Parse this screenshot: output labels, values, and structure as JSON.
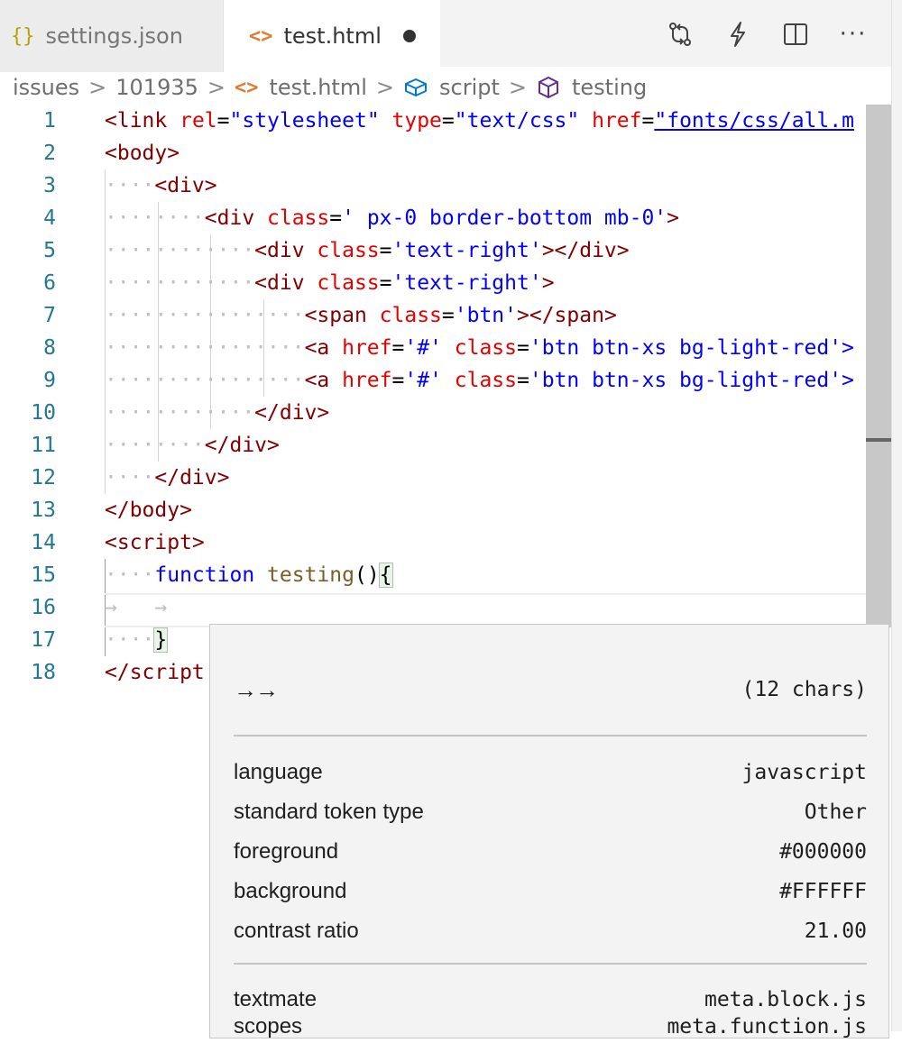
{
  "tabs": [
    {
      "label": "settings.json",
      "icon": "braces-icon",
      "active": false
    },
    {
      "label": "test.html",
      "icon": "angle-brackets-icon",
      "active": true,
      "dirty": true
    }
  ],
  "tab_glyphs": {
    "braces": "{}",
    "angle": "<>"
  },
  "actions": [
    "compare-changes-icon",
    "lightning-icon",
    "split-editor-icon",
    "more-icon"
  ],
  "more_glyph": "···",
  "breadcrumb": {
    "items": [
      "issues",
      "101935",
      "test.html",
      "script",
      "testing"
    ],
    "separator": ">"
  },
  "line_numbers": [
    "1",
    "2",
    "3",
    "4",
    "5",
    "6",
    "7",
    "8",
    "9",
    "10",
    "11",
    "12",
    "13",
    "14",
    "15",
    "16",
    "17",
    "18"
  ],
  "code": {
    "l1": {
      "a": "<link",
      "b": " rel",
      "c": "=",
      "d": "\"stylesheet\"",
      "e": " type",
      "f": "=",
      "g": "\"text/css\"",
      "h": " href",
      "i": "=",
      "j": "\"fonts/css/all.m"
    },
    "l2": "<body>",
    "l3": {
      "ws": "····",
      "t": "<div>"
    },
    "l4": {
      "ws": "········",
      "t1": "<div",
      "a": " class",
      "e": "=",
      "s": "' px-0 border-bottom mb-0'",
      "t2": ">"
    },
    "l5": {
      "ws": "············",
      "t1": "<div",
      "a": " class",
      "e": "=",
      "s": "'text-right'",
      "t2": "></div>"
    },
    "l6": {
      "ws": "············",
      "t1": "<div",
      "a": " class",
      "e": "=",
      "s": "'text-right'",
      "t2": ">"
    },
    "l7": {
      "ws": "················",
      "t1": "<span",
      "a": " class",
      "e": "=",
      "s": "'btn'",
      "t2": "></span>"
    },
    "l8": {
      "ws": "················",
      "t1": "<a",
      "a1": " href",
      "e1": "=",
      "s1": "'#'",
      "a2": " class",
      "e2": "=",
      "s2": "'btn btn-xs bg-light-red'>"
    },
    "l9": {
      "ws": "················",
      "t1": "<a",
      "a1": " href",
      "e1": "=",
      "s1": "'#'",
      "a2": " class",
      "e2": "=",
      "s2": "'btn btn-xs bg-light-red'>"
    },
    "l10": {
      "ws": "············",
      "t": "</div>"
    },
    "l11": {
      "ws": "········",
      "t": "</div>"
    },
    "l12": {
      "ws": "····",
      "t": "</div>"
    },
    "l13": "</body>",
    "l14": "<script>",
    "l15": {
      "ws": "····",
      "kw": "function",
      "sp": " ",
      "fn": "testing",
      "p": "()",
      "b": "{"
    },
    "l16": {
      "ws": "→   →"
    },
    "l17": {
      "ws": "····",
      "b": "}"
    },
    "l18": "</script"
  },
  "hover": {
    "token": "→→",
    "length": "(12 chars)",
    "rows": [
      {
        "label": "language",
        "value": "javascript"
      },
      {
        "label": "standard token type",
        "value": "Other"
      },
      {
        "label": "foreground",
        "value": "#000000"
      },
      {
        "label": "background",
        "value": "#FFFFFF"
      },
      {
        "label": "contrast ratio",
        "value": "21.00"
      }
    ],
    "textmate_label": "textmate",
    "scopes_label": "scopes",
    "scopes": [
      "meta.block.js",
      "meta.function.js"
    ]
  },
  "colors": {
    "accent": "#0078d4",
    "tag": "#800000",
    "attr": "#e50000",
    "string": "#0000ff",
    "function": "#795e26",
    "line_number": "#237893"
  }
}
